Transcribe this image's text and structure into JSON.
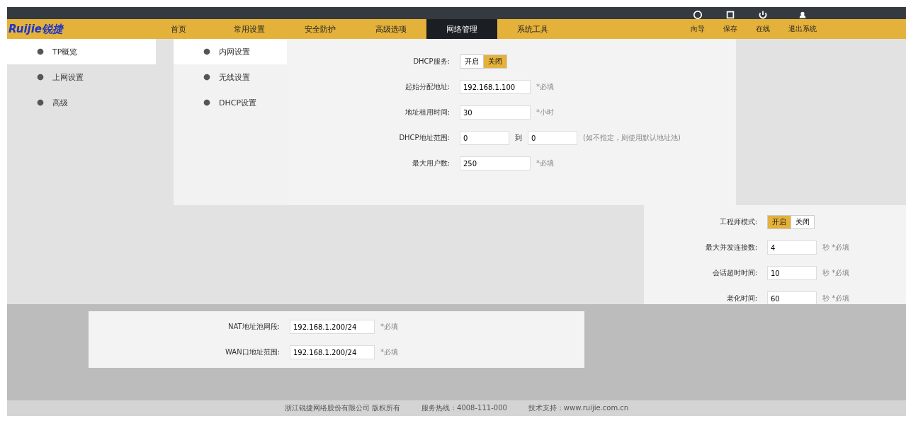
{
  "logo": "Ruijie锐捷",
  "nav": [
    {
      "label": "首页",
      "selected": false
    },
    {
      "label": "常用设置",
      "selected": false
    },
    {
      "label": "安全防护",
      "selected": false
    },
    {
      "label": "高级选项",
      "selected": false
    },
    {
      "label": "网络管理",
      "selected": true
    },
    {
      "label": "系统工具",
      "selected": false
    }
  ],
  "toolbar": [
    {
      "label": "向导"
    },
    {
      "label": "保存"
    },
    {
      "label": "在线"
    },
    {
      "label": "退出系统"
    }
  ],
  "sidebar": [
    {
      "label": "TP概览",
      "selected": true
    },
    {
      "label": "上网设置",
      "selected": false
    },
    {
      "label": "高级",
      "selected": false
    }
  ],
  "submenu": [
    {
      "label": "内网设置",
      "selected": true
    },
    {
      "label": "无线设置",
      "selected": false
    },
    {
      "label": "DHCP设置",
      "selected": false
    }
  ],
  "dhcp_form": [
    {
      "kind": "toggle",
      "label": "DHCP服务:",
      "options": [
        {
          "label": "开启",
          "selected": false
        },
        {
          "label": "关闭",
          "selected": true
        }
      ]
    },
    {
      "kind": "input",
      "label": "起始分配地址:",
      "value": "192.168.1.100",
      "hint": "*必填"
    },
    {
      "kind": "input",
      "label": "地址租用时间:",
      "value": "30",
      "hint": "*小时"
    },
    {
      "kind": "range",
      "label": "DHCP地址范围:",
      "from": "0",
      "sep": "到",
      "to": "0",
      "hint": "(如不指定，则使用默认地址池)"
    },
    {
      "kind": "input",
      "label": "最大用户数:",
      "value": "250",
      "hint": "*必填"
    }
  ],
  "advanced_form": [
    {
      "kind": "toggle",
      "label": "工程师模式:",
      "options": [
        {
          "label": "开启",
          "selected": true
        },
        {
          "label": "关闭",
          "selected": false
        }
      ]
    },
    {
      "kind": "input",
      "label": "最大并发连接数:",
      "value": "4",
      "hint": "秒 *必填"
    },
    {
      "kind": "input",
      "label": "会话超时时间:",
      "value": "10",
      "hint": "秒 *必填"
    },
    {
      "kind": "input",
      "label": "老化时间:",
      "value": "60",
      "hint": "秒 *必填"
    }
  ],
  "nat_form": [
    {
      "kind": "input",
      "label": "NAT地址池网段:",
      "value": "192.168.1.200/24",
      "hint": "*必填"
    },
    {
      "kind": "input",
      "label": "WAN口地址范围:",
      "value": "192.168.1.200/24",
      "hint": "*必填"
    }
  ],
  "footer": [
    "浙江锐捷网络股份有限公司 版权所有",
    "服务热线：4008-111-000",
    "技术支持：www.ruijie.com.cn"
  ]
}
